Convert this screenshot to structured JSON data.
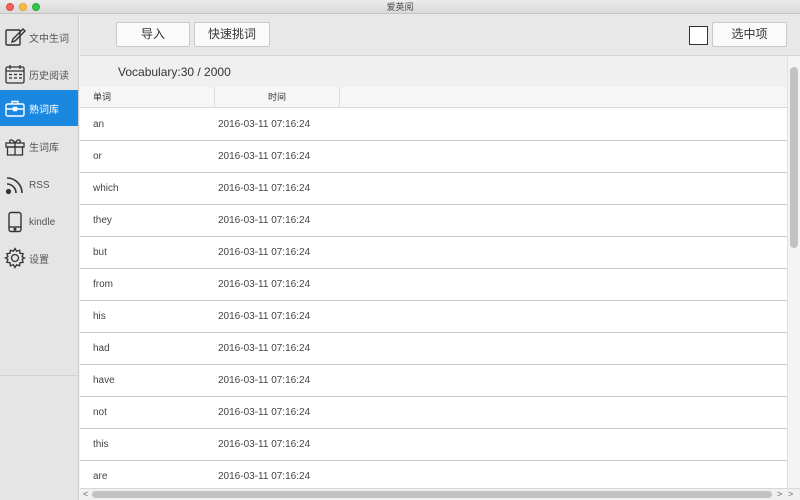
{
  "window": {
    "title": "爱英阅"
  },
  "sidebar": {
    "items": [
      {
        "label": "文中生词",
        "icon": "edit-icon"
      },
      {
        "label": "历史阅读",
        "icon": "calendar-icon"
      },
      {
        "label": "熟词库",
        "icon": "briefcase-icon"
      },
      {
        "label": "生词库",
        "icon": "gift-icon"
      },
      {
        "label": "RSS",
        "icon": "rss-icon"
      },
      {
        "label": "kindle",
        "icon": "phone-icon"
      },
      {
        "label": "设置",
        "icon": "gear-icon"
      }
    ],
    "active_index": 2
  },
  "toolbar": {
    "import_label": "导入",
    "quick_pick_label": "快速挑词",
    "selected_items_label": "选中项"
  },
  "vocabulary": {
    "count_text": "Vocabulary:30 / 2000"
  },
  "table": {
    "columns": [
      "单词",
      "时间"
    ],
    "rows": [
      {
        "word": "an",
        "time": "2016-03-11 07:16:24"
      },
      {
        "word": "or",
        "time": "2016-03-11 07:16:24"
      },
      {
        "word": "which",
        "time": "2016-03-11 07:16:24"
      },
      {
        "word": "they",
        "time": "2016-03-11 07:16:24"
      },
      {
        "word": "but",
        "time": "2016-03-11 07:16:24"
      },
      {
        "word": "from",
        "time": "2016-03-11 07:16:24"
      },
      {
        "word": "his",
        "time": "2016-03-11 07:16:24"
      },
      {
        "word": "had",
        "time": "2016-03-11 07:16:24"
      },
      {
        "word": "have",
        "time": "2016-03-11 07:16:24"
      },
      {
        "word": "not",
        "time": "2016-03-11 07:16:24"
      },
      {
        "word": "this",
        "time": "2016-03-11 07:16:24"
      },
      {
        "word": "are",
        "time": "2016-03-11 07:16:24"
      }
    ]
  },
  "scrollbar": {
    "left_arrow": "<",
    "right_arrow": ">",
    "right_arrow_2": ">"
  },
  "colors": {
    "accent": "#1a88e0",
    "sidebar_bg": "#e5e5e5"
  }
}
